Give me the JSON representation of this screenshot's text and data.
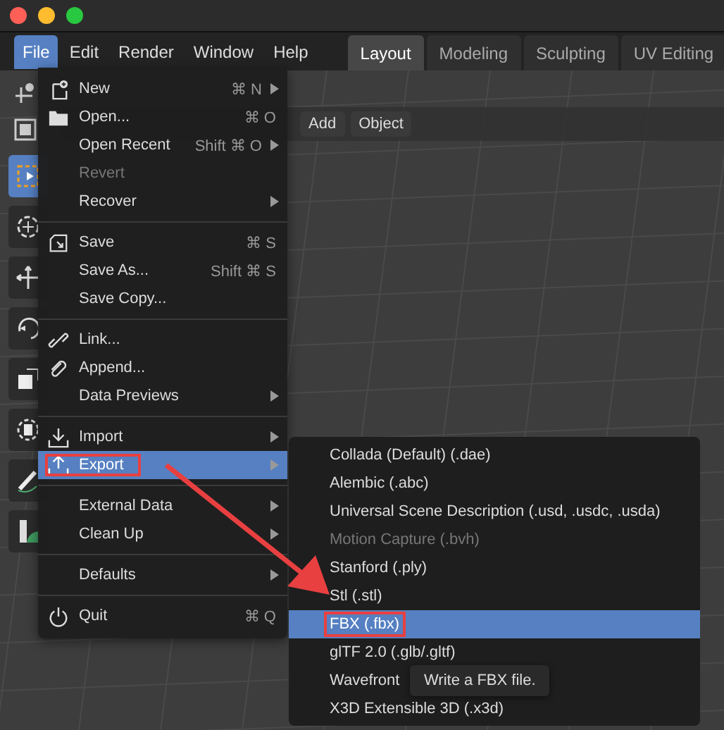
{
  "menu_bar": {
    "items": [
      {
        "label": "File",
        "selected": true
      },
      {
        "label": "Edit",
        "selected": false
      },
      {
        "label": "Render",
        "selected": false
      },
      {
        "label": "Window",
        "selected": false
      },
      {
        "label": "Help",
        "selected": false
      }
    ]
  },
  "workspace_tabs": [
    {
      "label": "Layout",
      "selected": true
    },
    {
      "label": "Modeling",
      "selected": false
    },
    {
      "label": "Sculpting",
      "selected": false
    },
    {
      "label": "UV Editing",
      "selected": false
    }
  ],
  "toolbar": [
    {
      "kind": "select",
      "selected": true
    },
    {
      "kind": "cursor",
      "selected": false
    },
    {
      "kind": "move",
      "selected": false
    },
    {
      "kind": "rotate",
      "selected": false
    },
    {
      "kind": "scale",
      "selected": false
    },
    {
      "kind": "transform",
      "selected": false
    },
    {
      "kind": "annotate",
      "selected": false
    },
    {
      "kind": "measure",
      "selected": false
    }
  ],
  "viewport_header": {
    "buttons": [
      "Add",
      "Object"
    ]
  },
  "file_menu": {
    "sections": [
      [
        {
          "label": "New",
          "kind": "new",
          "shortcut": "⌘ N",
          "submenu": true,
          "disabled": false,
          "selected": false,
          "marked": false
        },
        {
          "label": "Open...",
          "kind": "open",
          "shortcut": "⌘ O",
          "submenu": false,
          "disabled": false,
          "selected": false,
          "marked": false
        },
        {
          "label": "Open Recent",
          "kind": "plain",
          "shortcut": "Shift ⌘ O",
          "submenu": true,
          "disabled": false,
          "selected": false,
          "marked": false
        },
        {
          "label": "Revert",
          "kind": "plain",
          "disabled": true,
          "submenu": false,
          "selected": false,
          "marked": false
        },
        {
          "label": "Recover",
          "kind": "plain",
          "submenu": true,
          "disabled": false,
          "selected": false,
          "marked": false
        }
      ],
      [
        {
          "label": "Save",
          "kind": "save",
          "shortcut": "⌘ S",
          "submenu": false,
          "disabled": false,
          "selected": false,
          "marked": false
        },
        {
          "label": "Save As...",
          "kind": "plain",
          "shortcut": "Shift ⌘ S",
          "submenu": false,
          "disabled": false,
          "selected": false,
          "marked": false
        },
        {
          "label": "Save Copy...",
          "kind": "plain",
          "submenu": false,
          "disabled": false,
          "selected": false,
          "marked": false
        }
      ],
      [
        {
          "label": "Link...",
          "kind": "link",
          "submenu": false,
          "disabled": false,
          "selected": false,
          "marked": false
        },
        {
          "label": "Append...",
          "kind": "append",
          "submenu": false,
          "disabled": false,
          "selected": false,
          "marked": false
        },
        {
          "label": "Data Previews",
          "kind": "plain",
          "submenu": true,
          "disabled": false,
          "selected": false,
          "marked": false
        }
      ],
      [
        {
          "label": "Import",
          "kind": "import",
          "submenu": true,
          "disabled": false,
          "selected": false,
          "marked": false
        },
        {
          "label": "Export",
          "kind": "export",
          "submenu": true,
          "disabled": false,
          "selected": true,
          "marked": true
        }
      ],
      [
        {
          "label": "External Data",
          "kind": "plain",
          "submenu": true,
          "disabled": false,
          "selected": false,
          "marked": false
        },
        {
          "label": "Clean Up",
          "kind": "plain",
          "submenu": true,
          "disabled": false,
          "selected": false,
          "marked": false
        }
      ],
      [
        {
          "label": "Defaults",
          "kind": "plain",
          "submenu": true,
          "disabled": false,
          "selected": false,
          "marked": false
        }
      ],
      [
        {
          "label": "Quit",
          "kind": "quit",
          "shortcut": "⌘ Q",
          "submenu": false,
          "disabled": false,
          "selected": false,
          "marked": false
        }
      ]
    ]
  },
  "export_submenu": {
    "items": [
      {
        "label": "Collada (Default) (.dae)",
        "disabled": false,
        "selected": false,
        "marked": false
      },
      {
        "label": "Alembic (.abc)",
        "disabled": false,
        "selected": false,
        "marked": false
      },
      {
        "label": "Universal Scene Description (.usd, .usdc, .usda)",
        "disabled": false,
        "selected": false,
        "marked": false
      },
      {
        "label": "Motion Capture (.bvh)",
        "disabled": true,
        "selected": false,
        "marked": false
      },
      {
        "label": "Stanford (.ply)",
        "disabled": false,
        "selected": false,
        "marked": false
      },
      {
        "label": "Stl (.stl)",
        "disabled": false,
        "selected": false,
        "marked": false
      },
      {
        "label": "FBX (.fbx)",
        "disabled": false,
        "selected": true,
        "marked": true
      },
      {
        "label": "glTF 2.0 (.glb/.gltf)",
        "disabled": false,
        "selected": false,
        "marked": false
      },
      {
        "label": "Wavefront",
        "disabled": false,
        "selected": false,
        "marked": false
      },
      {
        "label": "X3D Extensible 3D (.x3d)",
        "disabled": false,
        "selected": false,
        "marked": false
      }
    ]
  },
  "tooltip": {
    "text": "Write a FBX file."
  }
}
